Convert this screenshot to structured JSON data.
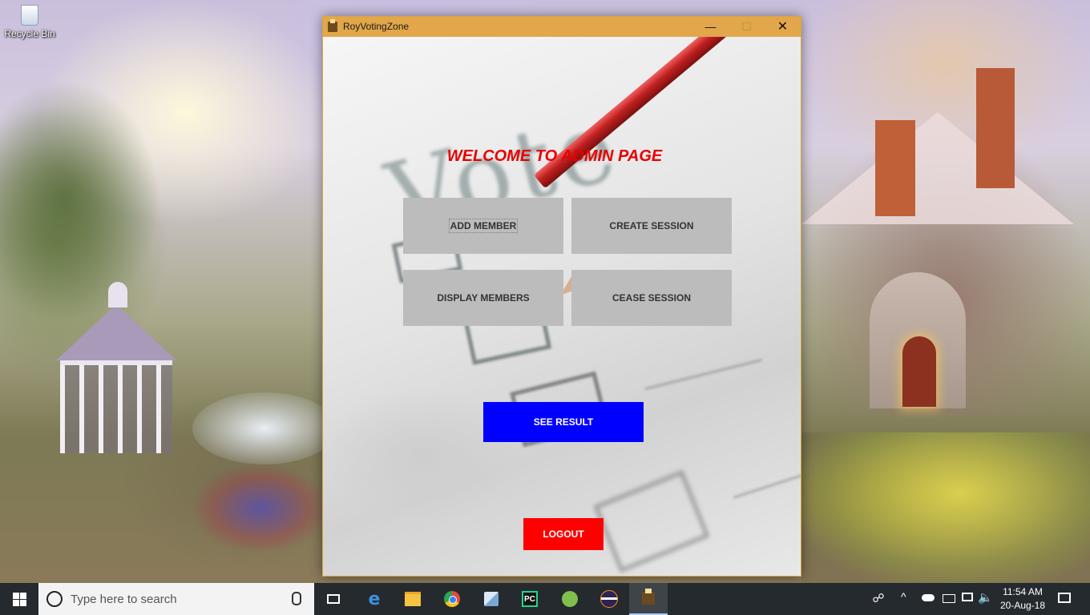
{
  "desktop": {
    "recycle_bin_label": "Recycle Bin"
  },
  "window": {
    "title": "RoyVotingZone",
    "title_bar_color": "#e1a74a",
    "controls": {
      "minimize": "—",
      "maximize": "☐",
      "close": "✕"
    }
  },
  "admin": {
    "heading": "WELCOME TO ADMIN PAGE",
    "heading_color": "#e60000",
    "buttons": {
      "add_member": "ADD MEMBER",
      "create_session": "CREATE SESSION",
      "display_members": "DISPLAY MEMBERS",
      "cease_session": "CEASE SESSION",
      "see_result": "SEE RESULT",
      "logout": "LOGOUT"
    },
    "colors": {
      "gray_button": "#bcbcbc",
      "see_result_bg": "#0000ff",
      "logout_bg": "#ff0000"
    }
  },
  "taskbar": {
    "search_placeholder": "Type here to search",
    "pinned_icons": [
      "task-view-icon",
      "edge-icon",
      "file-explorer-icon",
      "chrome-icon",
      "cube-app-icon",
      "pycharm-icon",
      "android-studio-icon",
      "eclipse-icon",
      "roy-voting-zone-icon"
    ],
    "active_app": "roy-voting-zone-icon",
    "pycharm_label": "PC",
    "tray": {
      "time": "11:54 AM",
      "date": "20-Aug-18"
    }
  }
}
